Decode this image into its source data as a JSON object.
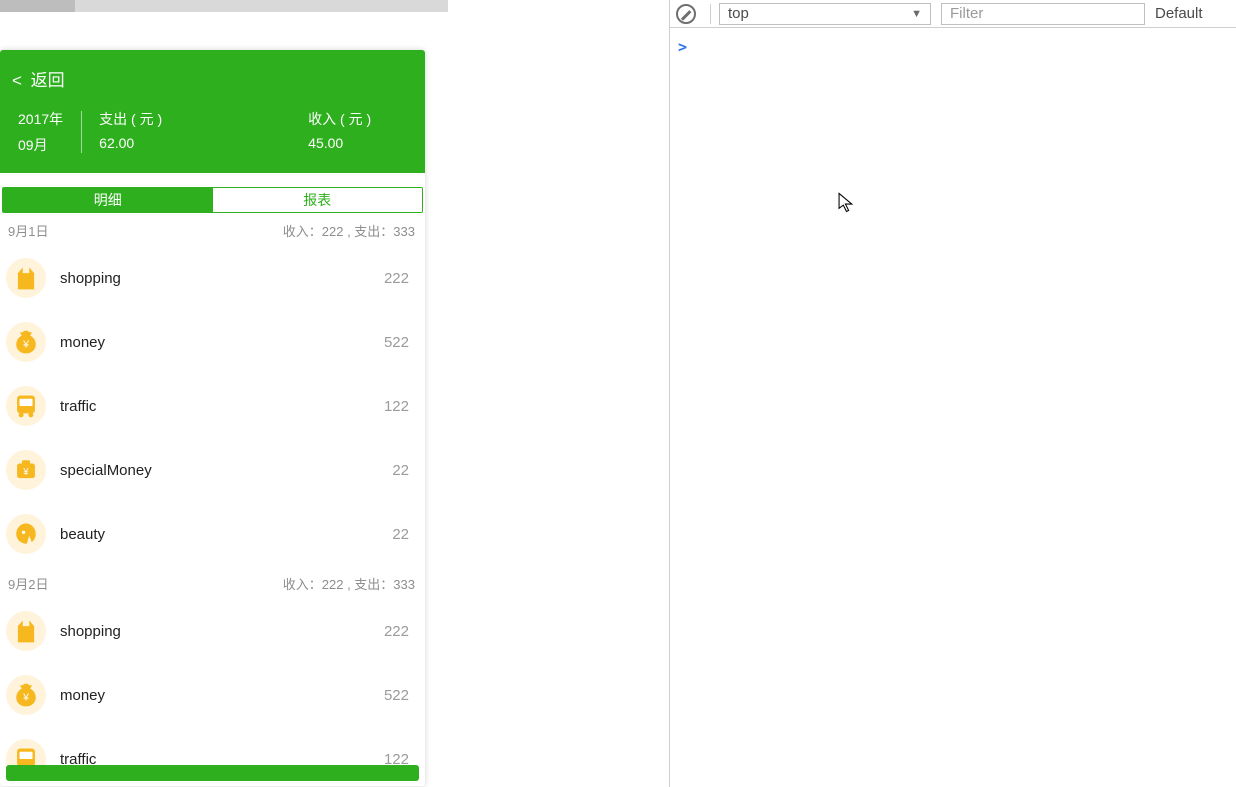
{
  "colors": {
    "green": "#2eaf1e",
    "icon": "#f6b81e"
  },
  "header": {
    "back_label": "返回",
    "year_line": "2017年",
    "month_line": "09月",
    "expense_label": "支出 ( 元 )",
    "expense_value": "62.00",
    "income_label": "收入 ( 元 )",
    "income_value": "45.00"
  },
  "tabs": {
    "detail": "明细",
    "report": "报表",
    "active": "detail"
  },
  "list_strings": {
    "income_prefix": "收入：",
    "expense_prefix": "支出：",
    "sep": " , "
  },
  "days": [
    {
      "date": "9月1日",
      "income": "222",
      "expense": "333",
      "items": [
        {
          "icon": "shopping",
          "name": "shopping",
          "amount": "222"
        },
        {
          "icon": "money",
          "name": "money",
          "amount": "522"
        },
        {
          "icon": "traffic",
          "name": "traffic",
          "amount": "122"
        },
        {
          "icon": "special",
          "name": "specialMoney",
          "amount": "22"
        },
        {
          "icon": "beauty",
          "name": "beauty",
          "amount": "22"
        }
      ]
    },
    {
      "date": "9月2日",
      "income": "222",
      "expense": "333",
      "items": [
        {
          "icon": "shopping",
          "name": "shopping",
          "amount": "222"
        },
        {
          "icon": "money",
          "name": "money",
          "amount": "522"
        },
        {
          "icon": "traffic",
          "name": "traffic",
          "amount": "122"
        }
      ]
    }
  ],
  "devtools": {
    "context": "top",
    "filter_placeholder": "Filter",
    "levels_label": "Default",
    "prompt": ">"
  }
}
